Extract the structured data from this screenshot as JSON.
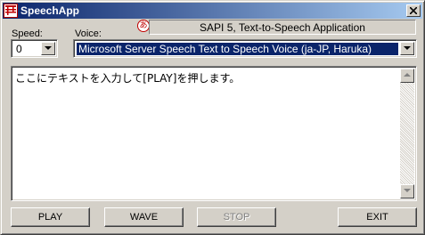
{
  "window": {
    "title": "SpeechApp",
    "close_glyph": "close-icon"
  },
  "header": {
    "sapi_info": "SAPI 5, Text-to-Speech Application",
    "hiragana_icon_char": "あ"
  },
  "controls": {
    "speed_label": "Speed:",
    "speed_value": "0",
    "voice_label": "Voice:",
    "voice_value": "Microsoft Server Speech Text to Speech Voice (ja-JP, Haruka)"
  },
  "text_area": {
    "value": "ここにテキストを入力して[PLAY]を押します。"
  },
  "buttons": {
    "play": "PLAY",
    "wave": "WAVE",
    "stop": "STOP",
    "exit": "EXIT"
  },
  "colors": {
    "titlebar": "#0a246a",
    "face": "#d4d0c8",
    "selection": "#0a246a"
  }
}
